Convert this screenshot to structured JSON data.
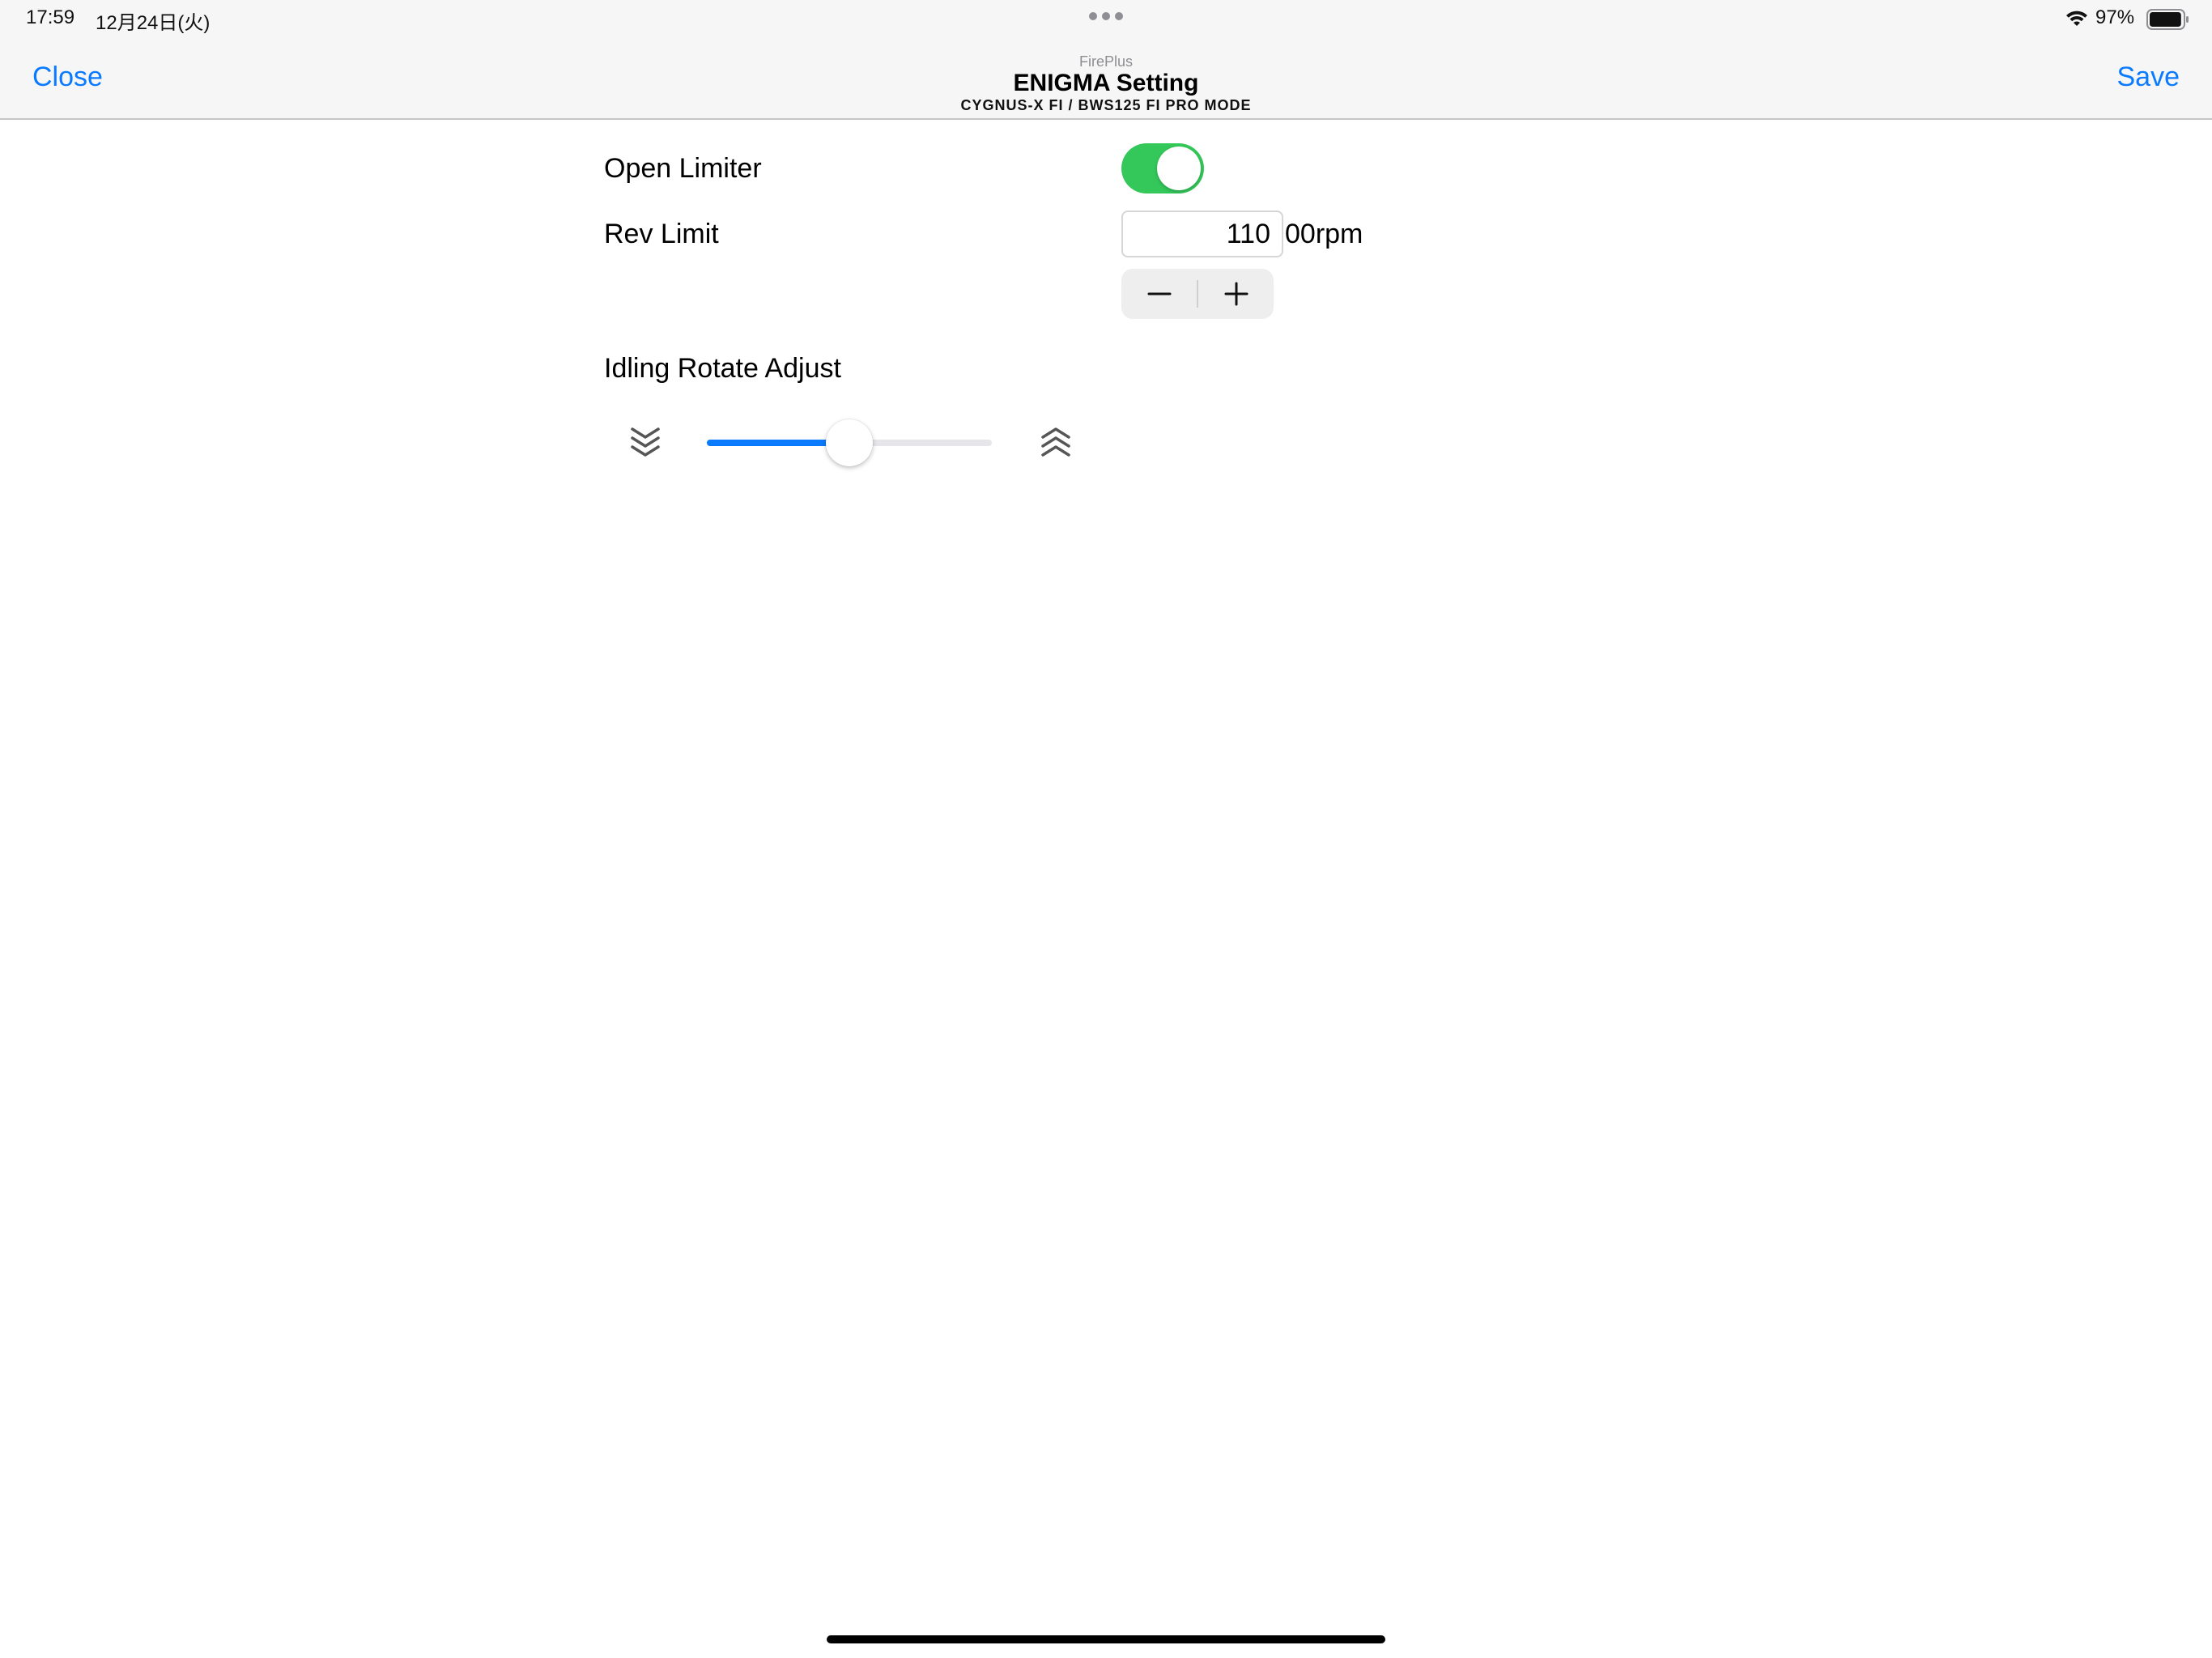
{
  "status_bar": {
    "time": "17:59",
    "date": "12月24日(火)",
    "battery_percent": "97%",
    "battery_level": 0.97
  },
  "nav": {
    "close_label": "Close",
    "save_label": "Save",
    "app_name": "FirePlus",
    "title": "ENIGMA Setting",
    "subtitle": "CYGNUS-X FI / BWS125 FI PRO MODE",
    "accent_color": "#0a7aff"
  },
  "settings": {
    "open_limiter": {
      "label": "Open Limiter",
      "enabled": true,
      "on_color": "#34c759"
    },
    "rev_limit": {
      "label": "Rev Limit",
      "value": "110",
      "unit": "00rpm"
    },
    "idling": {
      "label": "Idling Rotate Adjust",
      "slider_value": 0.5,
      "min_icon": "chevron-double-down-icon",
      "max_icon": "chevron-double-up-icon"
    }
  }
}
